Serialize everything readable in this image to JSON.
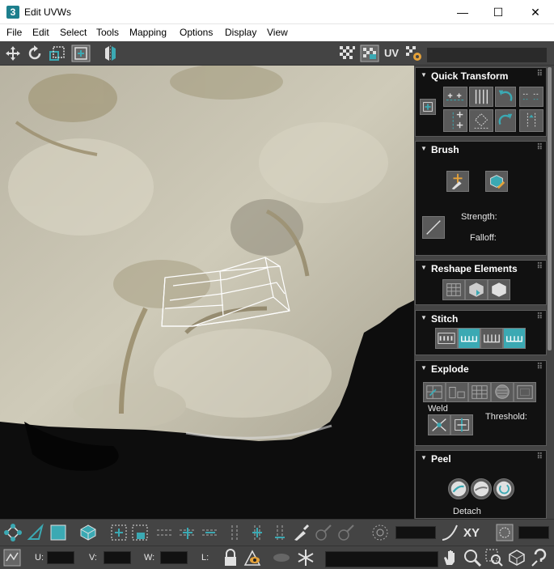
{
  "window": {
    "app_icon": "3",
    "title": "Edit UVWs",
    "minimize_glyph": "—",
    "maximize_glyph": "☐",
    "close_glyph": "✕"
  },
  "menu": [
    "File",
    "Edit",
    "Select",
    "Tools",
    "Mapping",
    "Options",
    "Display",
    "View"
  ],
  "toolbar": {
    "uv_label": "UV",
    "icons": [
      "move-icon",
      "rotate-icon",
      "scale-icon",
      "freeform-icon",
      "mirror-icon",
      "checker-icon",
      "checker-pattern-icon",
      "uv-label",
      "settings-icon"
    ]
  },
  "panels": {
    "quick_transform": {
      "title": "Quick Transform"
    },
    "brush": {
      "title": "Brush",
      "strength_label": "Strength:",
      "falloff_label": "Falloff:"
    },
    "reshape": {
      "title": "Reshape Elements"
    },
    "stitch": {
      "title": "Stitch"
    },
    "explode": {
      "title": "Explode",
      "weld_label": "Weld",
      "threshold_label": "Threshold:"
    },
    "peel": {
      "title": "Peel",
      "detach_label": "Detach"
    }
  },
  "bottom": {
    "xy_label": "XY",
    "u_label": "U:",
    "v_label": "V:",
    "w_label": "W:",
    "l_label": "L:"
  },
  "colors": {
    "accent": "#3ba9b3",
    "panel_bg": "#444444",
    "rollout_bg": "#111111",
    "text": "#e6e6e6"
  }
}
